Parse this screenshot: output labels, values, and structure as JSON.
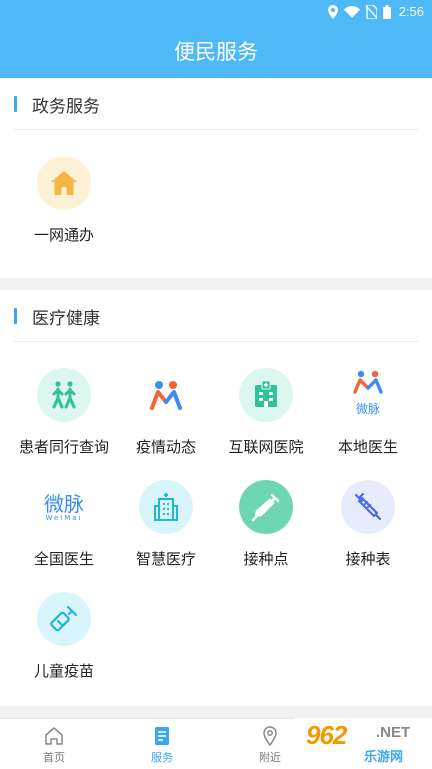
{
  "status_bar": {
    "time": "2:56"
  },
  "header": {
    "title": "便民服务"
  },
  "sections": [
    {
      "title": "政务服务",
      "items": [
        {
          "label": "一网通办",
          "icon": "home-icon"
        }
      ]
    },
    {
      "title": "医疗健康",
      "items": [
        {
          "label": "患者同行查询",
          "icon": "walking-people-icon"
        },
        {
          "label": "疫情动态",
          "icon": "people-m-icon"
        },
        {
          "label": "互联网医院",
          "icon": "hospital-icon"
        },
        {
          "label": "本地医生",
          "icon": "weimai-logo-icon",
          "logo_text": "微脉"
        },
        {
          "label": "全国医生",
          "icon": "weimai-text-logo-icon",
          "logo_text": "微脉",
          "logo_sub": "WeiMai"
        },
        {
          "label": "智慧医疗",
          "icon": "smart-building-icon"
        },
        {
          "label": "接种点",
          "icon": "syringe-icon"
        },
        {
          "label": "接种表",
          "icon": "syringe-outline-icon"
        },
        {
          "label": "儿童疫苗",
          "icon": "vaccine-vial-icon"
        }
      ]
    }
  ],
  "bottom_nav": [
    {
      "label": "首页",
      "icon": "home-outline-icon",
      "active": false
    },
    {
      "label": "服务",
      "icon": "document-icon",
      "active": true
    },
    {
      "label": "附近",
      "icon": "location-pin-icon",
      "active": false
    }
  ],
  "watermark": {
    "number": "962",
    "suffix": ".NET",
    "sub": "乐游网"
  },
  "colors": {
    "primary": "#4fb8f7",
    "accent": "#3aa7ee",
    "home_bg": "#fdf1d6",
    "home_icon": "#f6b645",
    "teal_bg": "#dcf6f0",
    "teal": "#2fc39a",
    "cyan_bg": "#d8f5fb",
    "cyan": "#21b6d9",
    "purple_bg": "#e7ecfd",
    "purple": "#4a6cf0"
  }
}
